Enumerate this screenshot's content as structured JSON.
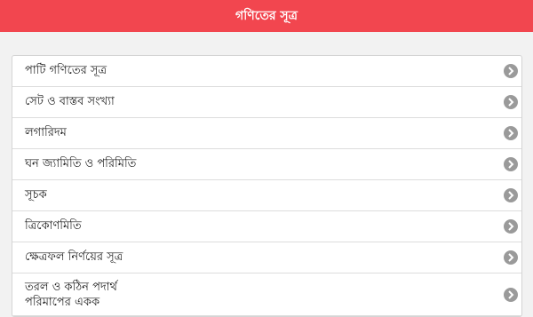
{
  "header": {
    "title": "গণিতের সূত্র",
    "color": "#f2464f"
  },
  "list": {
    "items": [
      {
        "label": "পাটি গণিতের সূত্র",
        "icon": "chevron-right-icon"
      },
      {
        "label": "সেট ও বাস্তব সংখ্যা",
        "icon": "chevron-right-icon"
      },
      {
        "label": "লগারিদম",
        "icon": "chevron-right-icon"
      },
      {
        "label": "ঘন জ্যামিতি ও পরিমিতি",
        "icon": "chevron-right-icon"
      },
      {
        "label": "সূচক",
        "icon": "chevron-right-icon"
      },
      {
        "label": "ত্রিকোণমিতি",
        "icon": "chevron-right-icon"
      },
      {
        "label": "ক্ষেত্রফল নির্ণয়ের সূত্র",
        "icon": "chevron-right-icon"
      },
      {
        "label_line1": "তরল ও কঠিন পদার্থ",
        "label_line2": "পরিমাপের একক",
        "icon": "chevron-right-icon"
      }
    ]
  }
}
